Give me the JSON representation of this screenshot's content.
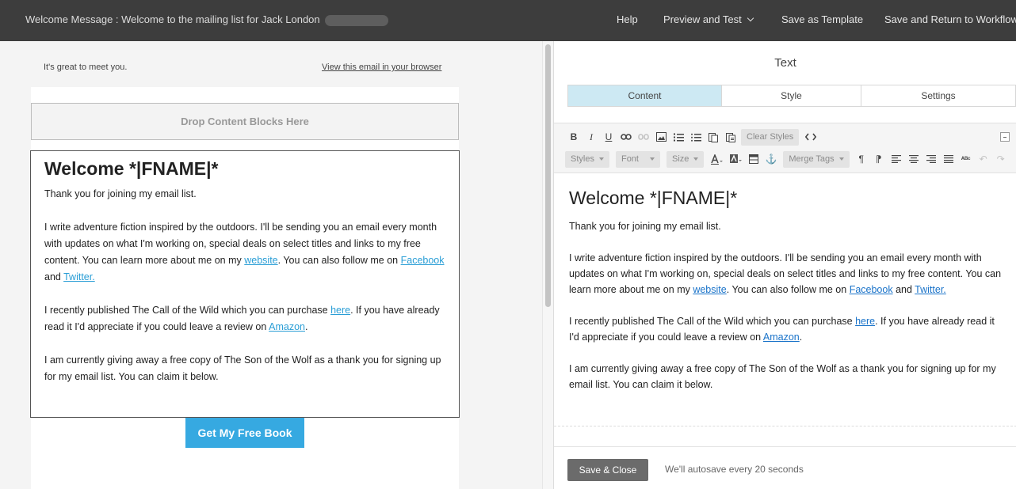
{
  "header": {
    "title": "Welcome Message : Welcome to the mailing list for Jack London",
    "nav": {
      "help": "Help",
      "preview": "Preview and Test",
      "save_template": "Save as Template",
      "save_return": "Save and Return to Workflow"
    }
  },
  "preview": {
    "preheader": "It's great to meet you.",
    "view_in_browser": "View this email in your browser",
    "drop_zone": "Drop Content Blocks Here",
    "button_label": "Get My Free Book"
  },
  "content": {
    "heading": "Welcome *|FNAME|*",
    "p1": "Thank you for joining my email list.",
    "p2_text1": "I write adventure fiction inspired by the outdoors. I'll be sending you an email every month with updates on what I'm working on, special deals on select titles and links to my free content. You can learn more about me on my ",
    "p2_link_website": "website",
    "p2_text2": ". You can also follow me on ",
    "p2_link_facebook": "Facebook",
    "p2_text3": " and ",
    "p2_link_twitter": "Twitter.",
    "p3_text1": "I recently published The Call of the Wild which you can purchase ",
    "p3_link_here": "here",
    "p3_text2": ". If you have already read it I'd appreciate if you could leave a review on ",
    "p3_link_amazon": "Amazon",
    "p3_text3": ".",
    "p4": "I am currently giving away a free copy of The Son of the Wolf as a thank you for signing up for my email list. You can claim it below."
  },
  "editor": {
    "panel_title": "Text",
    "tabs": [
      "Content",
      "Style",
      "Settings"
    ],
    "active_tab": "Content",
    "toolbar": {
      "clear_styles": "Clear Styles",
      "styles": "Styles",
      "font": "Font",
      "size": "Size",
      "merge_tags": "Merge Tags"
    },
    "save_close": "Save & Close",
    "autosave": "We'll autosave every 20 seconds"
  },
  "colors": {
    "topbar": "#3d3d3d",
    "active_tab": "#cde9f3",
    "cta": "#36a9e1",
    "link_preview": "#2a9ed6",
    "link_editor": "#1a73c9"
  }
}
